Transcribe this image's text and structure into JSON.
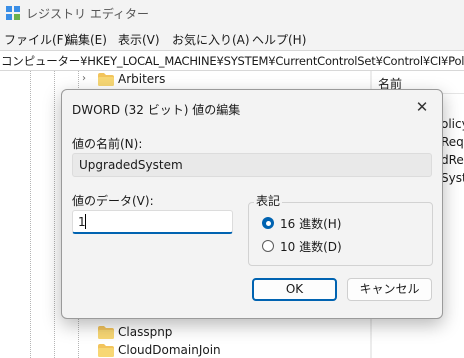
{
  "window": {
    "title": "レジストリ エディター",
    "menu": [
      "ファイル(F)",
      "編集(E)",
      "表示(V)",
      "お気に入り(A)",
      "ヘルプ(H)"
    ]
  },
  "address": "コンピューター¥HKEY_LOCAL_MACHINE¥SYSTEM¥CurrentControlSet¥Control¥CI¥Policy",
  "tree": {
    "items": [
      "Arbiters",
      "Classpnp",
      "CloudDomainJoin"
    ]
  },
  "values_pane": {
    "column_name": "名前",
    "rows": [
      "olicyP",
      "Req",
      "dRe",
      "Syst"
    ]
  },
  "dialog": {
    "title": "DWORD (32 ビット) 値の編集",
    "close_glyph": "✕",
    "value_name_label": "値の名前(N):",
    "value_name": "UpgradedSystem",
    "value_data_label": "値のデータ(V):",
    "value_data": "1",
    "radix_group_label": "表記",
    "radix_hex_label": "16 進数(H)",
    "radix_dec_label": "10 進数(D)",
    "radix_selected": "hex",
    "ok_label": "OK",
    "cancel_label": "キャンセル"
  },
  "colors": {
    "accent": "#0063b1",
    "folder": "#f2c45c"
  }
}
